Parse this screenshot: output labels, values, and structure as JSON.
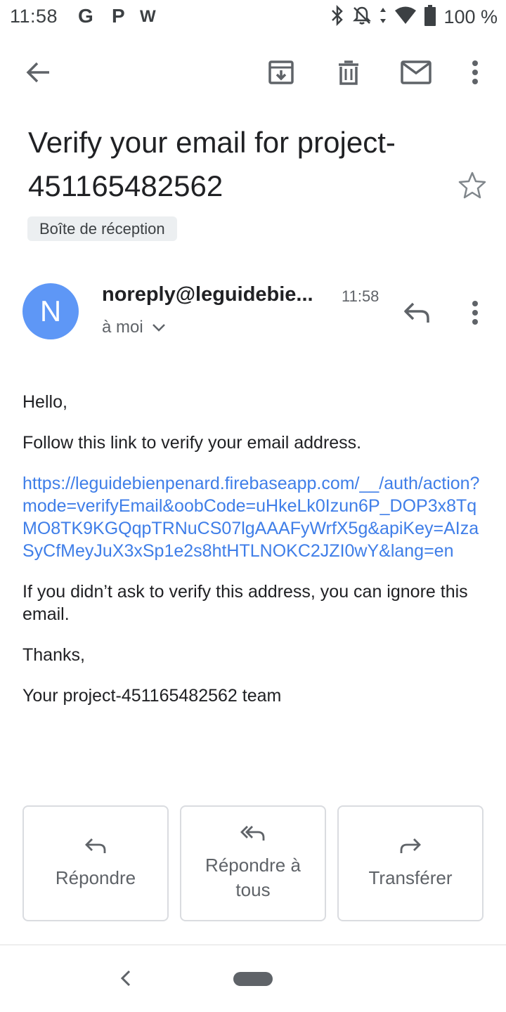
{
  "status_bar": {
    "time": "11:58",
    "apps": [
      "G",
      "P",
      "W"
    ],
    "battery": "100 %"
  },
  "toolbar": {
    "icons": [
      "back-arrow-icon",
      "archive-icon",
      "delete-icon",
      "mail-unread-icon",
      "more-vert-icon"
    ]
  },
  "email": {
    "subject": "Verify your email for project-451165482562",
    "label": "Boîte de réception",
    "sender": {
      "initial": "N",
      "name": "noreply@leguidebie...",
      "time": "11:58",
      "recipient": "à moi"
    },
    "body": {
      "greeting": "Hello,",
      "intro": "Follow this link to verify your email address.",
      "link": "https://leguidebienpenard.firebaseapp.com/__/auth/action?mode=verifyEmail&oobCode=uHkeLk0Izun6P_DOP3x8TqMO8TK9KGQqpTRNuCS07lgAAAFyWrfX5g&apiKey=AIzaSyCfMeyJuX3xSp1e2s8htHTLNOKC2JZI0wY&lang=en",
      "ignore_note": "If you didn’t ask to verify this address, you can ignore this email.",
      "thanks": "Thanks,",
      "signature": "Your project-451165482562 team"
    }
  },
  "actions": {
    "reply": "Répondre",
    "reply_all": "Répondre à tous",
    "forward": "Transférer"
  },
  "colors": {
    "avatar": "#5e97f6",
    "link": "#3f7ee8",
    "text": "#202124",
    "secondary": "#5f6368"
  }
}
